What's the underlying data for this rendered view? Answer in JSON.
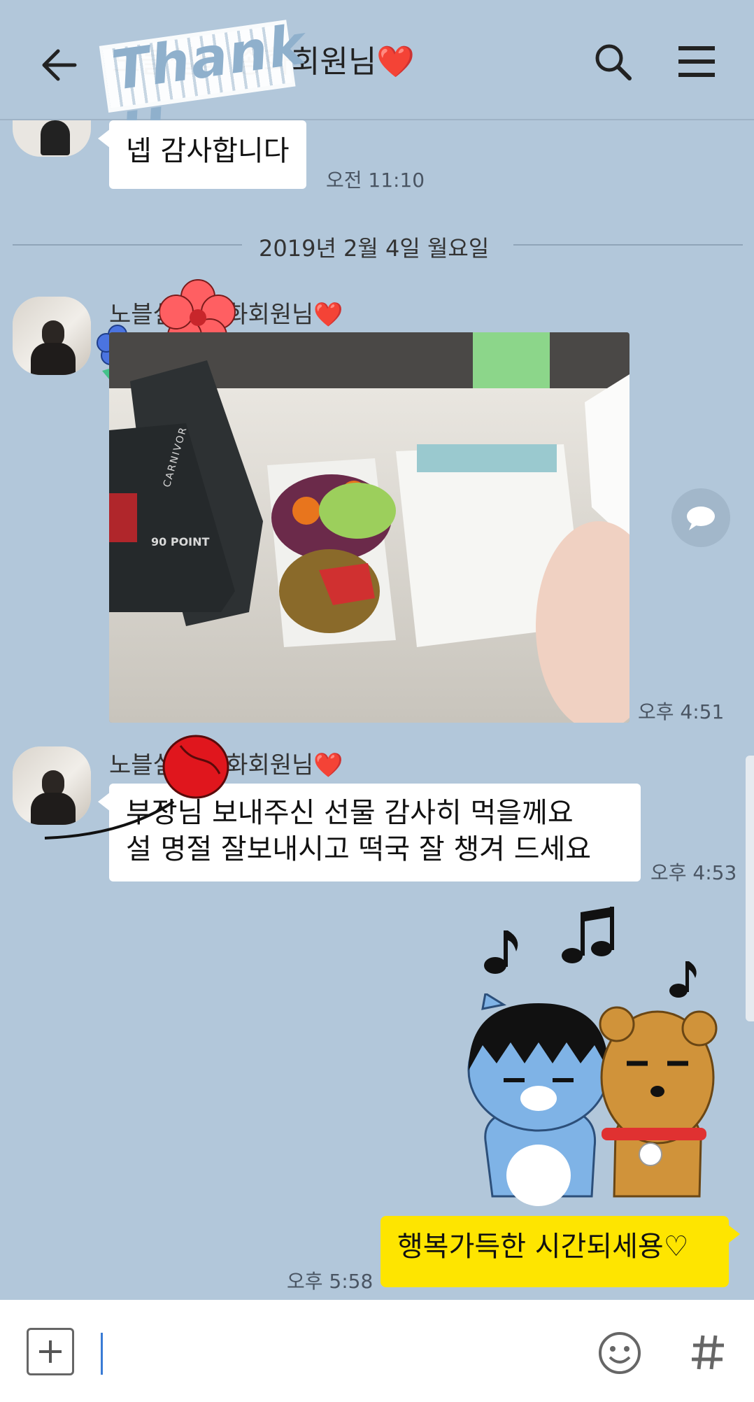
{
  "header": {
    "title": "노블실버 종화회원님❤️",
    "sticker_text": "Thank U",
    "back_icon": "arrow-left-icon",
    "search_icon": "search-icon",
    "menu_icon": "hamburger-menu-icon"
  },
  "messages": [
    {
      "text": "넵 감사합니다",
      "time": "오전 11:10"
    },
    {
      "date_divider": "2019년 2월 4일 월요일"
    },
    {
      "sender": "노블실버 종화회원님❤️",
      "type": "photo",
      "time": "오후 4:51"
    },
    {
      "sender": "노블실버 종화회원님❤️",
      "lines": [
        "부장님 보내주신 선물 감사히 먹을께요",
        "설 명절 잘보내시고  떡국 잘 챙겨 드세요"
      ],
      "time": "오후 4:53"
    },
    {
      "mine": true,
      "type": "emoticon",
      "text": "행복가득한 시간되세용♡",
      "time": "오후 5:58"
    }
  ],
  "photo_labels": {
    "brand": "CARNIVOR",
    "badge": "90 POINT"
  },
  "input": {
    "placeholder": "",
    "plus_icon": "plus-icon",
    "emoji_icon": "emoji-icon",
    "hash_icon": "hashtag-icon"
  },
  "colors": {
    "background": "#b2c7da",
    "my_bubble": "#fee500",
    "bubble": "#ffffff",
    "accent_caret": "#3a7bd5"
  }
}
